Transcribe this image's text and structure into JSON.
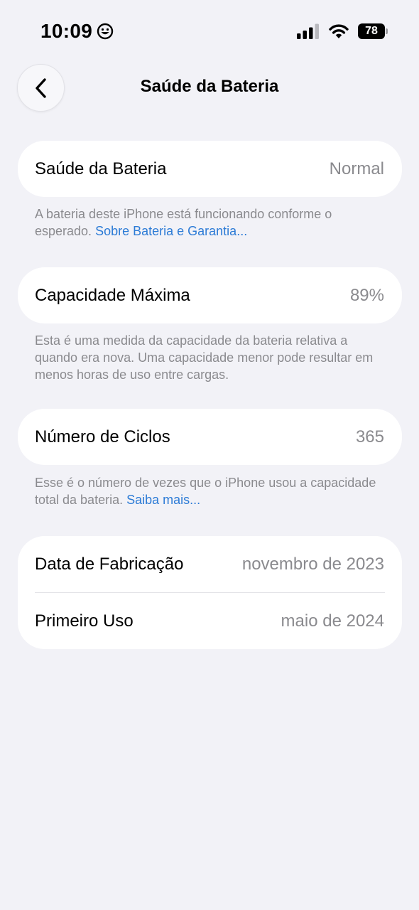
{
  "status_bar": {
    "time": "10:09",
    "battery_level": "78",
    "icons": [
      "smiley-icon",
      "cellular-signal-icon",
      "wifi-icon",
      "battery-icon"
    ]
  },
  "nav": {
    "title": "Saúde da Bateria",
    "back_icon": "chevron-left-icon"
  },
  "battery_health": {
    "label": "Saúde da Bateria",
    "value": "Normal",
    "footnote_text": "A bateria deste iPhone está funcionando conforme o esperado.",
    "footnote_link": "Sobre Bateria e Garantia..."
  },
  "max_capacity": {
    "label": "Capacidade Máxima",
    "value": "89%",
    "footnote_text": "Esta é uma medida da capacidade da bateria relativa a quando era nova. Uma capacidade menor pode resultar em menos horas de uso entre cargas."
  },
  "cycle_count": {
    "label": "Número de Ciclos",
    "value": "365",
    "footnote_text": "Esse é o número de vezes que o iPhone usou a capacidade total da bateria.",
    "footnote_link": "Saiba mais..."
  },
  "dates": {
    "manufacture_label": "Data de Fabricação",
    "manufacture_value": "novembro de 2023",
    "first_use_label": "Primeiro Uso",
    "first_use_value": "maio de 2024"
  },
  "colors": {
    "background": "#f2f2f7",
    "card": "#ffffff",
    "secondary_text": "#8a8a8e",
    "link": "#2c7bd6"
  }
}
